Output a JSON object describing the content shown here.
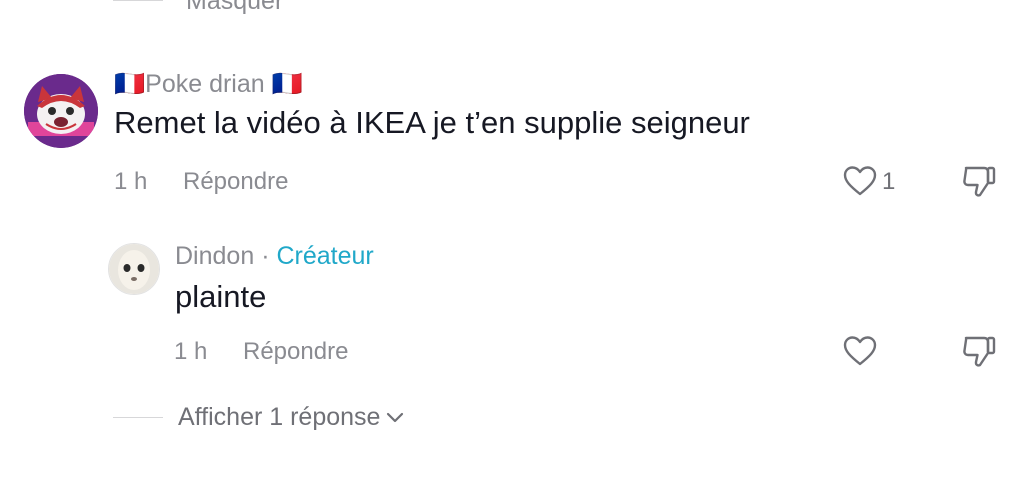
{
  "thread": {
    "collapse_label": "Masquer",
    "view_replies_label": "Afficher 1 réponse"
  },
  "comment": {
    "username_flag_left": "🇫🇷",
    "username": "Poke drian",
    "username_flag_right": "🇫🇷",
    "text": "Remet la vidéo à IKEA je t’en supplie seigneur",
    "time": "1 h",
    "reply_label": "Répondre",
    "like_count": "1"
  },
  "reply": {
    "username": "Dindon",
    "separator": "·",
    "badge": "Créateur",
    "text": "plainte",
    "time": "1 h",
    "reply_label": "Répondre"
  },
  "colors": {
    "text": "#161823",
    "muted": "#8a8b91",
    "creator_badge": "#20a8c9",
    "background": "#ffffff"
  },
  "icons": [
    "heart-icon",
    "dislike-icon",
    "chevron-down-icon"
  ]
}
